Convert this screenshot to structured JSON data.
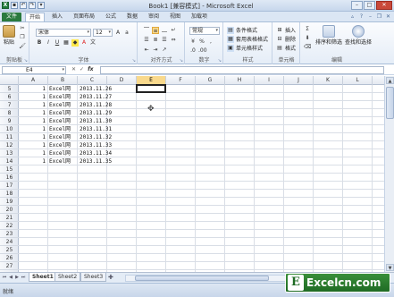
{
  "window": {
    "title": "Book1  [兼容模式] - Microsoft Excel",
    "min": "–",
    "max": "□",
    "close": "✕"
  },
  "ribbon_tabs": [
    "文件",
    "开始",
    "插入",
    "页面布局",
    "公式",
    "数据",
    "审阅",
    "视图",
    "加载项"
  ],
  "ribbon": {
    "clipboard": {
      "label": "剪贴板",
      "paste": "粘贴"
    },
    "font": {
      "label": "字体",
      "font_name": "宋体",
      "font_size": "12",
      "bold": "B",
      "italic": "I",
      "underline": "U"
    },
    "alignment": {
      "label": "对齐方式"
    },
    "number": {
      "label": "数字",
      "format": "常规"
    },
    "styles": {
      "label": "样式",
      "conditional": "条件格式",
      "table": "套用表格格式",
      "cell": "单元格样式"
    },
    "cells": {
      "label": "单元格",
      "insert": "插入",
      "delete": "删除",
      "format": "格式"
    },
    "editing": {
      "label": "编辑",
      "sort": "排序和筛选",
      "find": "查找和选择"
    }
  },
  "formula_bar": {
    "name_box": "E4",
    "fx": "fx",
    "value": ""
  },
  "grid": {
    "columns": [
      "A",
      "B",
      "C",
      "D",
      "E",
      "F",
      "G",
      "H",
      "I",
      "J",
      "K",
      "L"
    ],
    "selected_column": "E",
    "rows": [
      "5",
      "6",
      "7",
      "8",
      "9",
      "10",
      "11",
      "12",
      "13",
      "14",
      "15",
      "16",
      "17",
      "18",
      "19",
      "20",
      "21",
      "22",
      "23",
      "24",
      "25",
      "26",
      "27"
    ],
    "data": [
      {
        "a": "1",
        "b": "Excel网",
        "c": "2013.11.26"
      },
      {
        "a": "1",
        "b": "Excel网",
        "c": "2013.11.27"
      },
      {
        "a": "1",
        "b": "Excel网",
        "c": "2013.11.28"
      },
      {
        "a": "1",
        "b": "Excel网",
        "c": "2013.11.29"
      },
      {
        "a": "1",
        "b": "Excel网",
        "c": "2013.11.30"
      },
      {
        "a": "1",
        "b": "Excel网",
        "c": "2013.11.31"
      },
      {
        "a": "1",
        "b": "Excel网",
        "c": "2013.11.32"
      },
      {
        "a": "1",
        "b": "Excel网",
        "c": "2013.11.33"
      },
      {
        "a": "1",
        "b": "Excel网",
        "c": "2013.11.34"
      },
      {
        "a": "1",
        "b": "Excel网",
        "c": "2013.11.35"
      }
    ]
  },
  "sheets": [
    "Sheet1",
    "Sheet2",
    "Sheet3"
  ],
  "active_sheet": "Sheet1",
  "status": "就绪",
  "watermark": {
    "logo": "E",
    "text": "Excelcn.com"
  },
  "colors": {
    "file_tab": "#2a7a3e",
    "selected_header": "#f9d98c",
    "watermark_green": "#1f6b24"
  }
}
